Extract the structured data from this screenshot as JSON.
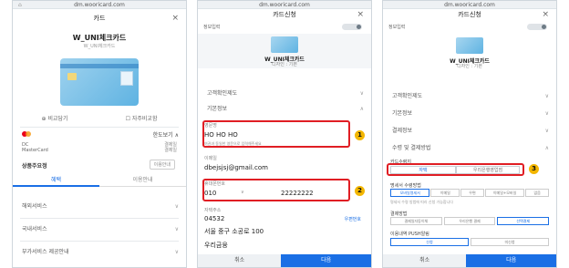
{
  "phone1": {
    "url": "dm.wooricard.com",
    "title": "카드",
    "close": "×",
    "card_name": "W_UNI체크카드",
    "card_sub": "W_UNI체크카드",
    "link_left": "⊕ 비교담기",
    "link_right": "☐ 자주비교함",
    "brand_row": "한도보기 ∧",
    "left_small_1": "DC",
    "left_small_2": "MasterCard",
    "right_small_1": "결제일",
    "right_small_2": "결제일",
    "chip_left": "상품주요정",
    "chip_right": "이용안내",
    "tab_left": "혜택",
    "tab_right": "이용안내",
    "rows": [
      "해외서비스",
      "국내서비스",
      "부가서비스 제공안내"
    ]
  },
  "phone2": {
    "url": "dm.wooricard.com",
    "title": "카드신청",
    "close": "×",
    "step_label": "정보입력",
    "card_name": "W_UNI체크카드",
    "card_sub": "디자인 : 기본",
    "section1": "고객확인제도",
    "section2": "기본정보",
    "name_label": "영문명",
    "name_value": "HO HO HO",
    "name_hint": "여권과 동일한 영문으로 입력해주세요",
    "email_label": "이메일",
    "email_value": "dbejsjsj@gmail.com",
    "phone_label": "휴대폰번호",
    "phone_prefix": "010",
    "phone_value": "22222222",
    "address_label": "자택주소",
    "zip": "04532",
    "zip_btn": "우편번호",
    "addr1": "서울 중구 소공로 100",
    "addr2": "우리금융",
    "btn_cancel": "취소",
    "btn_next": "다음",
    "badge1": "1",
    "badge2": "2"
  },
  "phone3": {
    "url": "dm.wooricard.com",
    "title": "카드신청",
    "close": "×",
    "step_label": "정보입력",
    "card_name": "W_UNI체크카드",
    "card_sub": "디자인 : 기본",
    "rows": [
      "고객확인제도",
      "기본정보",
      "결제정보",
      "수령 및 결제방법"
    ],
    "receive_label": "카드수령지",
    "receive_opt1": "자택",
    "receive_opt2": "우리은행영업점",
    "statement_label": "명세서 수령방법",
    "st_opts": [
      "모바일명세서",
      "이메일",
      "우편",
      "이메일+모바일",
      "없음"
    ],
    "st_note": "명세서 수령 방법에 따라 신청 가능합니다",
    "pay_label": "결제방법",
    "pay_opts": [
      "결제일자동이체",
      "우리은행 결제",
      "선택결제"
    ],
    "biz_label": "이용내역 PUSH알림",
    "biz_opts": [
      "신청",
      "미신청"
    ],
    "btn_cancel": "취소",
    "btn_next": "다음",
    "badge3": "3"
  },
  "colors": {
    "accent": "#1a6fe5",
    "highlight": "#e01e24",
    "badge": "#f3b600"
  }
}
